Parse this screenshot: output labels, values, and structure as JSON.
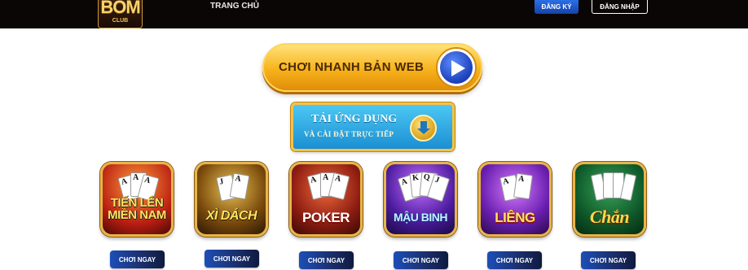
{
  "header": {
    "logo_text": "BOM",
    "logo_sub": "CLUB",
    "nav_home": "TRANG CHỦ",
    "register_label": "ĐĂNG KÝ",
    "login_label": "ĐĂNG NHẬP"
  },
  "web_play": {
    "label": "CHƠI NHANH BẢN WEB"
  },
  "app_download": {
    "title": "TẢI ỨNG DỤNG",
    "subtitle": "VÀ CÀI ĐẶT TRỰC TIẾP"
  },
  "games": [
    {
      "name": "TIẾN LÊN\nMIỀN NAM",
      "button": "CHƠI NGAY"
    },
    {
      "name": "XÌ DÁCH",
      "button": "CHƠI NGAY"
    },
    {
      "name": "POKER",
      "button": "CHƠI NGAY"
    },
    {
      "name": "MẬU BINH",
      "button": "CHƠI NGAY"
    },
    {
      "name": "LIÊNG",
      "button": "CHƠI NGAY"
    },
    {
      "name": "Chắn",
      "button": "CHƠI NGAY"
    }
  ],
  "colors": {
    "topbar": "#0b0606",
    "accent_gold": "#e7b54a",
    "button_blue": "#1d4fb8"
  }
}
